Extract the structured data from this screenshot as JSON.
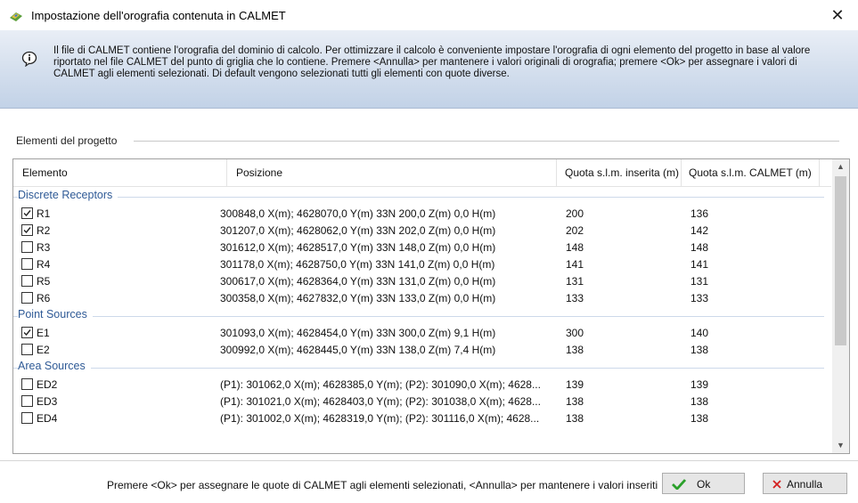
{
  "window": {
    "title": "Impostazione dell'orografia contenuta in CALMET",
    "close_glyph": "✕"
  },
  "info": {
    "text": "Il file di CALMET contiene l'orografia del dominio di calcolo. Per ottimizzare il calcolo è conveniente impostare l'orografia di ogni elemento del progetto in base al valore riportato nel file CALMET del punto di griglia che lo contiene. Premere <Annulla> per mantenere i valori originali di orografia; premere <Ok> per assegnare i valori di CALMET agli elementi selezionati. Di default vengono selezionati tutti gli elementi con quote diverse."
  },
  "group_label": "Elementi del progetto",
  "table": {
    "headers": [
      "Elemento",
      "Posizione",
      "Quota s.l.m. inserita (m)",
      "Quota s.l.m. CALMET (m)"
    ],
    "sections": [
      {
        "name": "Discrete Receptors",
        "rows": [
          {
            "name": "R1",
            "checked": true,
            "pos": "300848,0 X(m); 4628070,0 Y(m) 33N  200,0 Z(m) 0,0 H(m)",
            "q1": "200",
            "q2": "136"
          },
          {
            "name": "R2",
            "checked": true,
            "pos": "301207,0 X(m); 4628062,0 Y(m) 33N  202,0 Z(m) 0,0 H(m)",
            "q1": "202",
            "q2": "142"
          },
          {
            "name": "R3",
            "checked": false,
            "pos": "301612,0 X(m); 4628517,0 Y(m) 33N  148,0 Z(m) 0,0 H(m)",
            "q1": "148",
            "q2": "148"
          },
          {
            "name": "R4",
            "checked": false,
            "pos": "301178,0 X(m); 4628750,0 Y(m) 33N  141,0 Z(m) 0,0 H(m)",
            "q1": "141",
            "q2": "141"
          },
          {
            "name": "R5",
            "checked": false,
            "pos": "300617,0 X(m); 4628364,0 Y(m) 33N  131,0 Z(m) 0,0 H(m)",
            "q1": "131",
            "q2": "131"
          },
          {
            "name": "R6",
            "checked": false,
            "pos": "300358,0 X(m); 4627832,0 Y(m) 33N  133,0 Z(m) 0,0 H(m)",
            "q1": "133",
            "q2": "133"
          }
        ]
      },
      {
        "name": "Point Sources",
        "rows": [
          {
            "name": "E1",
            "checked": true,
            "pos": "301093,0 X(m); 4628454,0 Y(m) 33N  300,0 Z(m) 9,1 H(m)",
            "q1": "300",
            "q2": "140"
          },
          {
            "name": "E2",
            "checked": false,
            "pos": "300992,0 X(m); 4628445,0 Y(m) 33N  138,0 Z(m) 7,4 H(m)",
            "q1": "138",
            "q2": "138"
          }
        ]
      },
      {
        "name": "Area Sources",
        "rows": [
          {
            "name": "ED2",
            "checked": false,
            "pos": "(P1): 301062,0 X(m); 4628385,0 Y(m); (P2): 301090,0 X(m); 4628...",
            "q1": "139",
            "q2": "139"
          },
          {
            "name": "ED3",
            "checked": false,
            "pos": "(P1): 301021,0 X(m); 4628403,0 Y(m); (P2): 301038,0 X(m); 4628...",
            "q1": "138",
            "q2": "138"
          },
          {
            "name": "ED4",
            "checked": false,
            "pos": "(P1): 301002,0 X(m); 4628319,0 Y(m); (P2): 301116,0 X(m); 4628...",
            "q1": "138",
            "q2": "138"
          }
        ]
      }
    ]
  },
  "footer": {
    "text": "Premere <Ok> per assegnare le quote di CALMET agli elementi selezionati, <Annulla> per mantenere i valori inseriti",
    "ok_label": "Ok",
    "cancel_label": "Annulla"
  },
  "colors": {
    "section_text": "#2f5a96",
    "ok_check": "#2aa02a",
    "cancel_x": "#d42020"
  }
}
